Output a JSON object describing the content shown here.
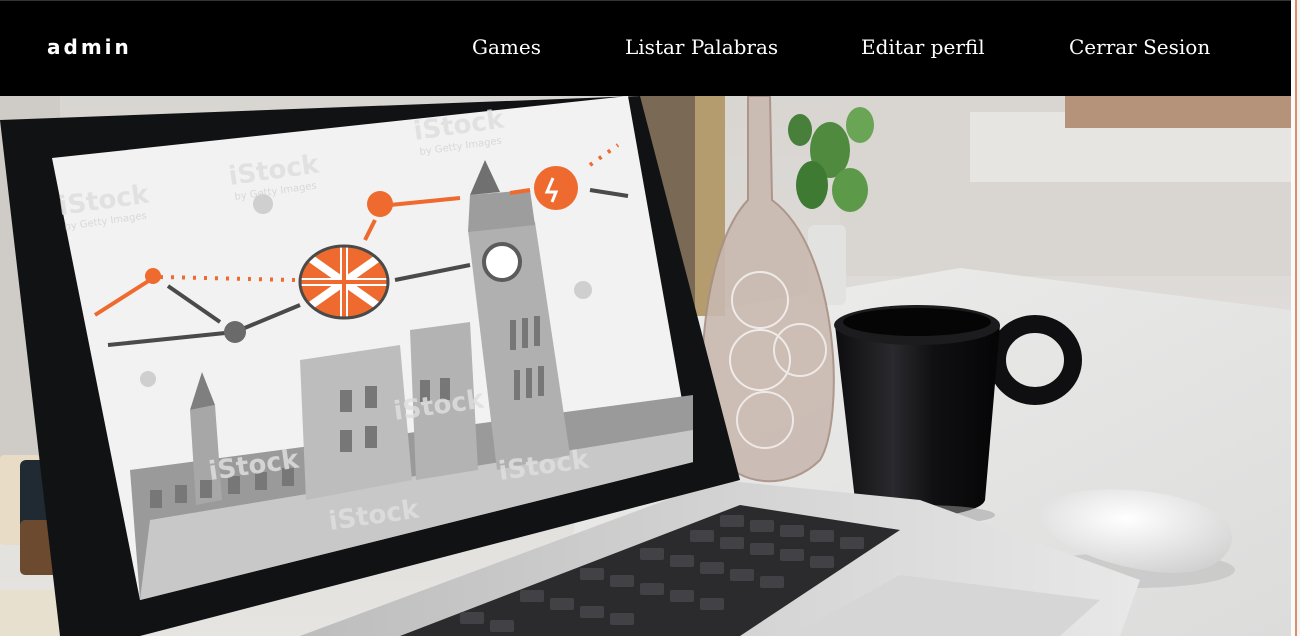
{
  "navbar": {
    "brand": "admin",
    "links": [
      {
        "label": "Games"
      },
      {
        "label": "Listar Palabras"
      },
      {
        "label": "Editar perfil"
      },
      {
        "label": "Cerrar Sesion"
      }
    ]
  },
  "hero": {
    "screen_watermark": "iStock",
    "screen_watermark_sub": "by Getty Images"
  },
  "colors": {
    "navbar_bg": "#000000",
    "nav_text": "#ffffff",
    "accent_orange": "#ee6a2e"
  }
}
